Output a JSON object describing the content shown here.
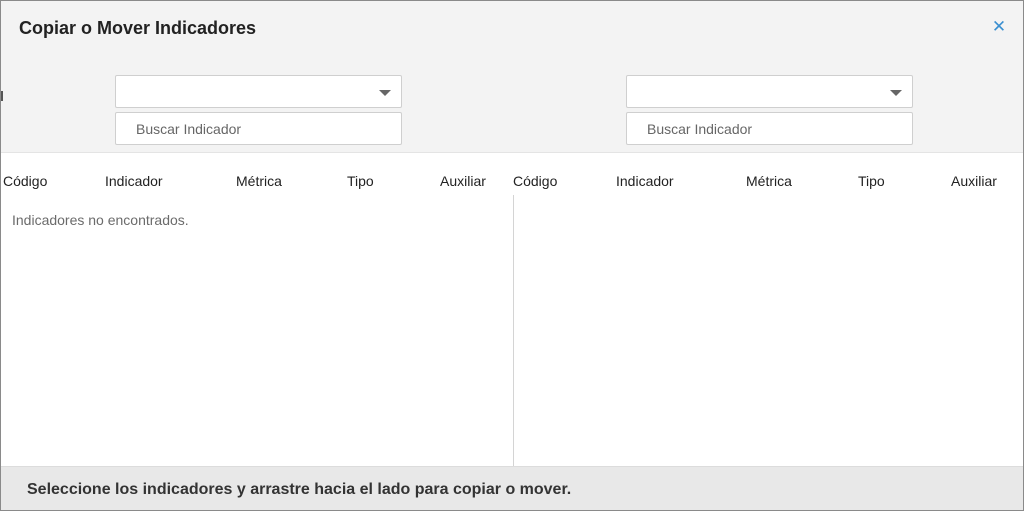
{
  "modal": {
    "title": "Copiar o Mover Indicadores",
    "close_icon": "close-icon"
  },
  "left_panel": {
    "select_value": "",
    "search_placeholder": "Buscar Indicador",
    "columns": [
      "Código",
      "Indicador",
      "Métrica",
      "Tipo",
      "Auxiliar"
    ],
    "empty_message": "Indicadores no encontrados."
  },
  "right_panel": {
    "select_value": "",
    "search_placeholder": "Buscar Indicador",
    "columns": [
      "Código",
      "Indicador",
      "Métrica",
      "Tipo",
      "Auxiliar"
    ]
  },
  "footer": {
    "instructions": "Seleccione los indicadores y arrastre hacia el lado para copiar o mover."
  },
  "colors": {
    "accent": "#3a8fd0",
    "header_bg": "#f3f3f3",
    "footer_bg": "#e8e8e8"
  }
}
